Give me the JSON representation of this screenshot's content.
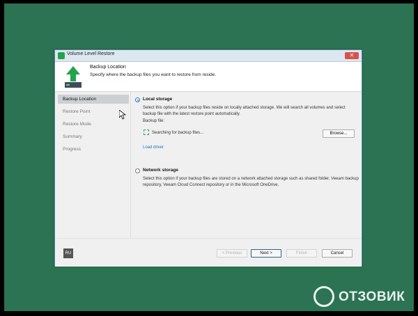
{
  "window": {
    "title": "Volume Level Restore"
  },
  "header": {
    "title": "Backup Location",
    "subtitle": "Specify where the backup files you want to restore from reside."
  },
  "sidebar": {
    "items": [
      {
        "label": "Backup Location",
        "active": true
      },
      {
        "label": "Restore Point"
      },
      {
        "label": "Restore Mode"
      },
      {
        "label": "Summary"
      },
      {
        "label": "Progress"
      }
    ]
  },
  "local": {
    "label": "Local storage",
    "selected": true,
    "description": "Select this option if your backup files reside on locally attached storage. We will search all volumes and select backup file with the latest restore point automatically.",
    "backup_file_label": "Backup file:",
    "status": "Searching for backup files...",
    "browse_label": "Browse...",
    "load_driver_label": "Load driver"
  },
  "network": {
    "label": "Network storage",
    "selected": false,
    "description": "Select this option if your backup files are stored on a network attached storage such as shared folder, Veeam backup repository, Veeam Cloud Connect repository or in the Microsoft OneDrive."
  },
  "footer": {
    "language": "RU",
    "previous_label": "< Previous",
    "next_label": "Next >",
    "finish_label": "Finish",
    "cancel_label": "Cancel"
  },
  "watermark": {
    "text": "ОТЗОВИК"
  },
  "colors": {
    "desktop": "#2b7352",
    "accent": "#1f6fc5",
    "header_arrow": "#23a34a"
  }
}
